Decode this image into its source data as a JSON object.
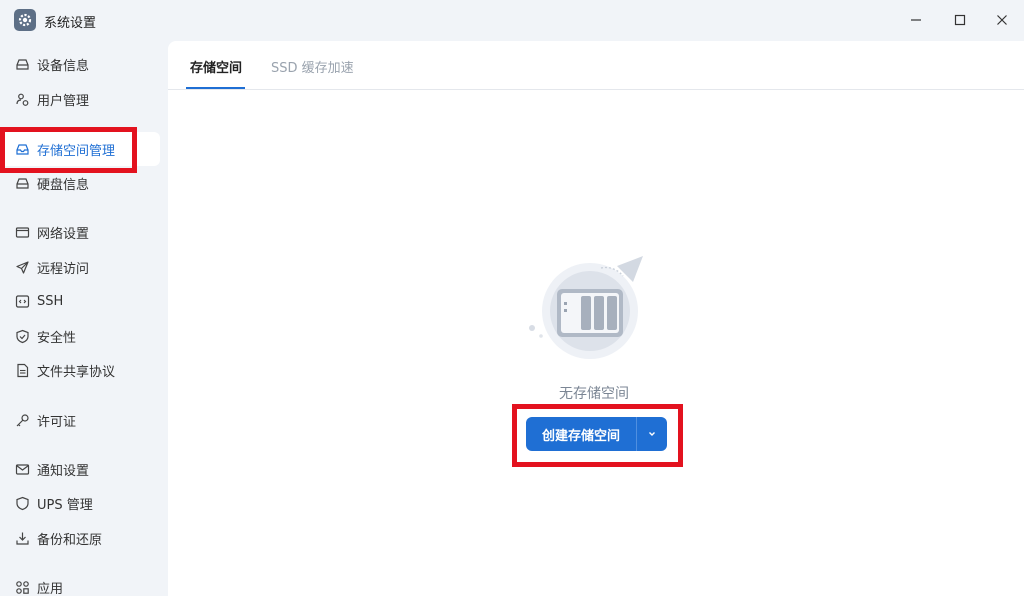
{
  "window": {
    "title": "系统设置",
    "app_icon": "gear-icon"
  },
  "sidebar": {
    "items": [
      {
        "label": "设备信息",
        "icon": "drive-icon"
      },
      {
        "label": "用户管理",
        "icon": "users-icon"
      },
      {
        "label": "存储空间管理",
        "icon": "storage-icon",
        "active": true
      },
      {
        "label": "硬盘信息",
        "icon": "disk-icon"
      },
      {
        "label": "网络设置",
        "icon": "network-icon"
      },
      {
        "label": "远程访问",
        "icon": "send-icon"
      },
      {
        "label": "SSH",
        "icon": "code-icon"
      },
      {
        "label": "安全性",
        "icon": "shield-icon"
      },
      {
        "label": "文件共享协议",
        "icon": "document-icon"
      },
      {
        "label": "许可证",
        "icon": "key-icon"
      },
      {
        "label": "通知设置",
        "icon": "mail-icon"
      },
      {
        "label": "UPS 管理",
        "icon": "shield-outline-icon"
      },
      {
        "label": "备份和还原",
        "icon": "backup-icon"
      },
      {
        "label": "应用",
        "icon": "apps-icon"
      }
    ]
  },
  "tabs": [
    {
      "label": "存储空间",
      "active": true
    },
    {
      "label": "SSD 缓存加速",
      "active": false
    }
  ],
  "empty_state": {
    "message": "无存储空间"
  },
  "create_button": {
    "label": "创建存储空间"
  },
  "colors": {
    "accent": "#1f6fd4",
    "highlight": "#e3121f",
    "sidebar_bg": "#f1f4f8"
  }
}
